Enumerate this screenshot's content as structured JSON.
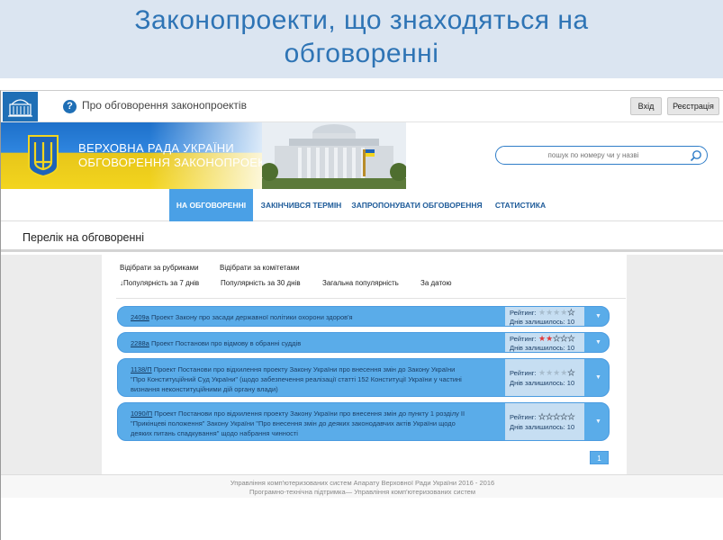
{
  "slide": {
    "title_line1": "Законопроекти, що знаходяться на",
    "title_line2": "обговоренні"
  },
  "topbar": {
    "help_label": "Про обговорення законопроектів",
    "login_label": "Вхід",
    "register_label": "Реєстрація"
  },
  "banner": {
    "line1": "ВЕРХОВНА РАДА УКРАЇНИ",
    "line2": "ОБГОВОРЕННЯ ЗАКОНОПРОЕКТІВ",
    "search_placeholder": "пошук по номеру чи у назві"
  },
  "nav": {
    "items": [
      {
        "label": "НА ОБГОВОРЕННІ",
        "active": true
      },
      {
        "label": "ЗАКІНЧИВСЯ ТЕРМІН",
        "active": false
      },
      {
        "label": "ЗАПРОПОНУВАТИ ОБГОВОРЕННЯ",
        "active": false
      },
      {
        "label": "СТАТИСТИКА",
        "active": false
      }
    ]
  },
  "heading": "Перелік на обговоренні",
  "filters": {
    "by_rubrics": "Відібрати за рубриками",
    "by_committees": "Відібрати за комітетами",
    "popular_7": "↓Популярність за 7 днів",
    "popular_30": "Популярність за 30 днів",
    "popular_all": "Загальна популярність",
    "by_date": "За датою"
  },
  "bills": [
    {
      "number": "2409а",
      "lines": [
        "Проект Закону про засади державної політики охорони здоров'я"
      ],
      "rating_label": "Рейтинг:",
      "rating": 0,
      "days_label": "Днів залишилось: 10"
    },
    {
      "number": "2288а",
      "lines": [
        "Проект Постанови про відмову в обранні суддів"
      ],
      "rating_label": "Рейтинг:",
      "rating": 2,
      "days_label": "Днів залишилось: 10"
    },
    {
      "number": "1138/П",
      "lines": [
        "Проект Постанови про відхилення проекту Закону України про внесення змін до Закону України",
        "\"Про Конституційний Суд України\" (щодо забезпечення реалізації статті 152 Конституції України у частині",
        "визнання неконституційними дій органу влади)"
      ],
      "rating_label": "Рейтинг:",
      "rating": 0,
      "days_label": "Днів залишилось: 10"
    },
    {
      "number": "1090/П",
      "lines": [
        "Проект Постанови про відхилення проекту Закону України про внесення змін до пункту 1 розділу II",
        "\"Прикінцеві положення\" Закону України \"Про внесення змін до деяких законодавчих актів України щодо",
        "деяких питань спадкування\" щодо набрання чинності"
      ],
      "rating_label": "Рейтинг:",
      "rating": 0,
      "days_label": "Днів залишилось: 10"
    }
  ],
  "pager": {
    "current": "1"
  },
  "footer": {
    "line1": "Управління комп'ютеризованих систем Апарату Верховної Ради України 2016 - 2016",
    "line2": "Програмно-технічна підтримка— Управління комп'ютеризованих систем"
  },
  "colors": {
    "accent": "#4aa0e6",
    "row": "#5aace9",
    "row_side": "#c6def2",
    "title": "#2e74b5"
  },
  "icons": [
    "parliament-logo-icon",
    "help-icon",
    "trident-icon",
    "search-icon",
    "star-icon",
    "chevron-down-icon"
  ]
}
